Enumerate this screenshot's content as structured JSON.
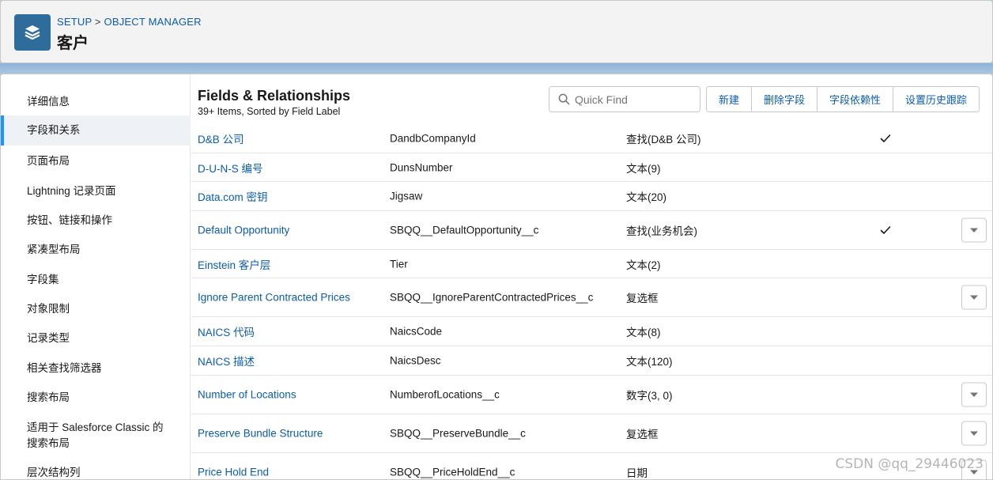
{
  "header": {
    "breadcrumb_setup": "SETUP",
    "breadcrumb_sep": ">",
    "breadcrumb_object_manager": "OBJECT MANAGER",
    "title": "客户",
    "icon": "layers-icon"
  },
  "sidebar": {
    "items": [
      {
        "label": "详细信息",
        "active": false
      },
      {
        "label": "字段和关系",
        "active": true
      },
      {
        "label": "页面布局",
        "active": false
      },
      {
        "label": "Lightning 记录页面",
        "active": false
      },
      {
        "label": "按钮、链接和操作",
        "active": false
      },
      {
        "label": "紧凑型布局",
        "active": false
      },
      {
        "label": "字段集",
        "active": false
      },
      {
        "label": "对象限制",
        "active": false
      },
      {
        "label": "记录类型",
        "active": false
      },
      {
        "label": "相关查找筛选器",
        "active": false
      },
      {
        "label": "搜索布局",
        "active": false
      },
      {
        "label": "适用于 Salesforce Classic 的搜索布局",
        "active": false
      },
      {
        "label": "层次结构列",
        "active": false
      }
    ]
  },
  "main": {
    "title": "Fields & Relationships",
    "subtitle": "39+ Items, Sorted by Field Label",
    "search_placeholder": "Quick Find",
    "buttons": {
      "new": "新建",
      "delete_fields": "删除字段",
      "field_dependencies": "字段依赖性",
      "history_tracking": "设置历史跟踪"
    },
    "rows": [
      {
        "label": "D&B 公司",
        "api": "DandbCompanyId",
        "type": "查找(D&B 公司)",
        "indexed": true,
        "menu": false
      },
      {
        "label": "D-U-N-S 编号",
        "api": "DunsNumber",
        "type": "文本(9)",
        "indexed": false,
        "menu": false
      },
      {
        "label": "Data.com 密钥",
        "api": "Jigsaw",
        "type": "文本(20)",
        "indexed": false,
        "menu": false
      },
      {
        "label": "Default Opportunity",
        "api": "SBQQ__DefaultOpportunity__c",
        "type": "查找(业务机会)",
        "indexed": true,
        "menu": true
      },
      {
        "label": "Einstein 客户层",
        "api": "Tier",
        "type": "文本(2)",
        "indexed": false,
        "menu": false
      },
      {
        "label": "Ignore Parent Contracted Prices",
        "api": "SBQQ__IgnoreParentContractedPrices__c",
        "type": "复选框",
        "indexed": false,
        "menu": true
      },
      {
        "label": "NAICS 代码",
        "api": "NaicsCode",
        "type": "文本(8)",
        "indexed": false,
        "menu": false
      },
      {
        "label": "NAICS 描述",
        "api": "NaicsDesc",
        "type": "文本(120)",
        "indexed": false,
        "menu": false
      },
      {
        "label": "Number of Locations",
        "api": "NumberofLocations__c",
        "type": "数字(3, 0)",
        "indexed": false,
        "menu": true
      },
      {
        "label": "Preserve Bundle Structure",
        "api": "SBQQ__PreserveBundle__c",
        "type": "复选框",
        "indexed": false,
        "menu": true
      },
      {
        "label": "Price Hold End",
        "api": "SBQQ__PriceHoldEnd__c",
        "type": "日期",
        "indexed": false,
        "menu": true
      }
    ]
  },
  "watermark": "CSDN @qq_29446023",
  "colors": {
    "link": "#0b5cab",
    "accent": "#1b96ff",
    "app_icon": "#2e6c9c"
  }
}
